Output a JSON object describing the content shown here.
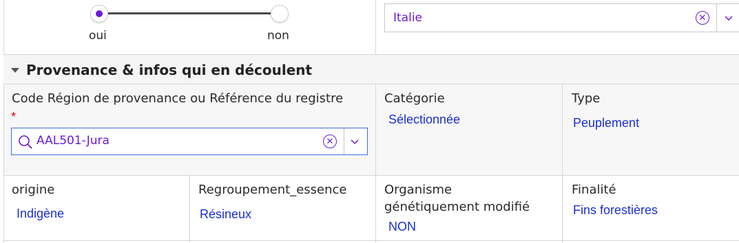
{
  "slider": {
    "label_yes": "oui",
    "label_no": "non",
    "selected": "oui"
  },
  "country_select": {
    "value": "Italie",
    "clear_icon": "close-circle-icon",
    "dropdown_icon": "chevron-down-icon"
  },
  "section": {
    "title": "Provenance & infos qui en découlent",
    "collapse_icon": "caret-down-icon"
  },
  "fields": {
    "region_code": {
      "label": "Code Région de provenance ou Référence du registre",
      "required_mark": "*",
      "value": "AAL501-Jura",
      "search_icon": "search-icon"
    },
    "categorie": {
      "label": "Catégorie",
      "value": "Sélectionnée"
    },
    "type": {
      "label": "Type",
      "value": "Peuplement"
    },
    "origine": {
      "label": "origine",
      "value": "Indigène"
    },
    "regroupement": {
      "label": "Regroupement_essence",
      "value": "Résineux"
    },
    "ogm": {
      "label_line1": "Organisme",
      "label_line2": "génétiquement modifié",
      "value": "NON"
    },
    "finalite": {
      "label": "Finalité",
      "value": "Fins forestières"
    }
  },
  "colors": {
    "accent": "#6a1bd6",
    "link": "#1a2fd0",
    "input_border_focus": "#3b6fd8",
    "required": "#d0021b"
  }
}
